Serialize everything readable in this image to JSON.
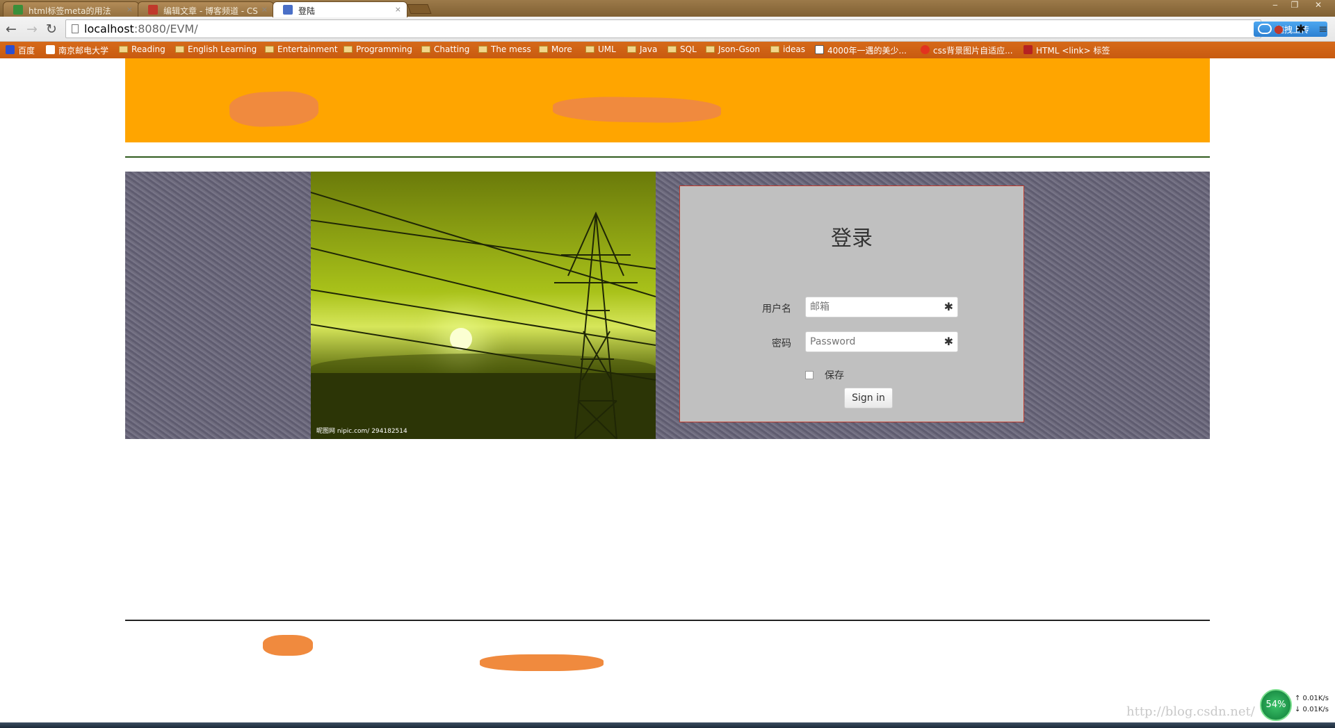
{
  "browser": {
    "tabs": [
      {
        "title": "html标签meta的用法",
        "favicon_color": "#3a8f3a"
      },
      {
        "title": "编辑文章 - 博客频道 - CS",
        "favicon_color": "#c0392b"
      },
      {
        "title": "登陆",
        "favicon_color": "#4a6fc7",
        "active": true
      }
    ],
    "close_glyph": "×",
    "window_controls": [
      "‒",
      "❐",
      "✕"
    ],
    "nav": {
      "back_icon": "←",
      "forward_icon": "→",
      "reload_icon": "↻"
    },
    "url": {
      "host": "localhost",
      "rest": ":8080/EVM/"
    },
    "upload_button": "拖拽上传",
    "extension_icons": [
      "●",
      "✱",
      "≡"
    ],
    "bookmarks": [
      {
        "label": "百度",
        "kind": "site",
        "color": "#2b4fd0"
      },
      {
        "label": "南京邮电大学",
        "kind": "page"
      },
      {
        "label": "Reading",
        "kind": "folder"
      },
      {
        "label": "English Learning",
        "kind": "folder"
      },
      {
        "label": "Entertainment",
        "kind": "folder"
      },
      {
        "label": "Programming",
        "kind": "folder"
      },
      {
        "label": "Chatting",
        "kind": "folder"
      },
      {
        "label": "The mess",
        "kind": "folder"
      },
      {
        "label": "More",
        "kind": "folder"
      },
      {
        "label": "UML",
        "kind": "folder"
      },
      {
        "label": "Java",
        "kind": "folder"
      },
      {
        "label": "SQL",
        "kind": "folder"
      },
      {
        "label": "Json-Gson",
        "kind": "folder"
      },
      {
        "label": "ideas",
        "kind": "folder"
      },
      {
        "label": "4000年一遇的美少...",
        "kind": "site",
        "color": "#ffffff"
      },
      {
        "label": "css背景图片自适应...",
        "kind": "site",
        "color": "#e2331f"
      },
      {
        "label": "HTML <link> 标签",
        "kind": "site",
        "color": "#b52222"
      }
    ]
  },
  "page": {
    "header_color": "#ffa500",
    "photo_caption": "昵图网 nipic.com/ 294182514",
    "login": {
      "title": "登录",
      "username_label": "用户名",
      "username_placeholder": "邮箱",
      "password_label": "密码",
      "password_placeholder": "Password",
      "required_mark": "✱",
      "remember_label": "保存",
      "signin_button": "Sign in",
      "border_color": "#c0392b"
    },
    "watermark": "http://blog.csdn.net/"
  },
  "tray": {
    "cpu_percent": "54%",
    "up_rate": "↑ 0.01K/s",
    "down_rate": "↓ 0.01K/s"
  }
}
